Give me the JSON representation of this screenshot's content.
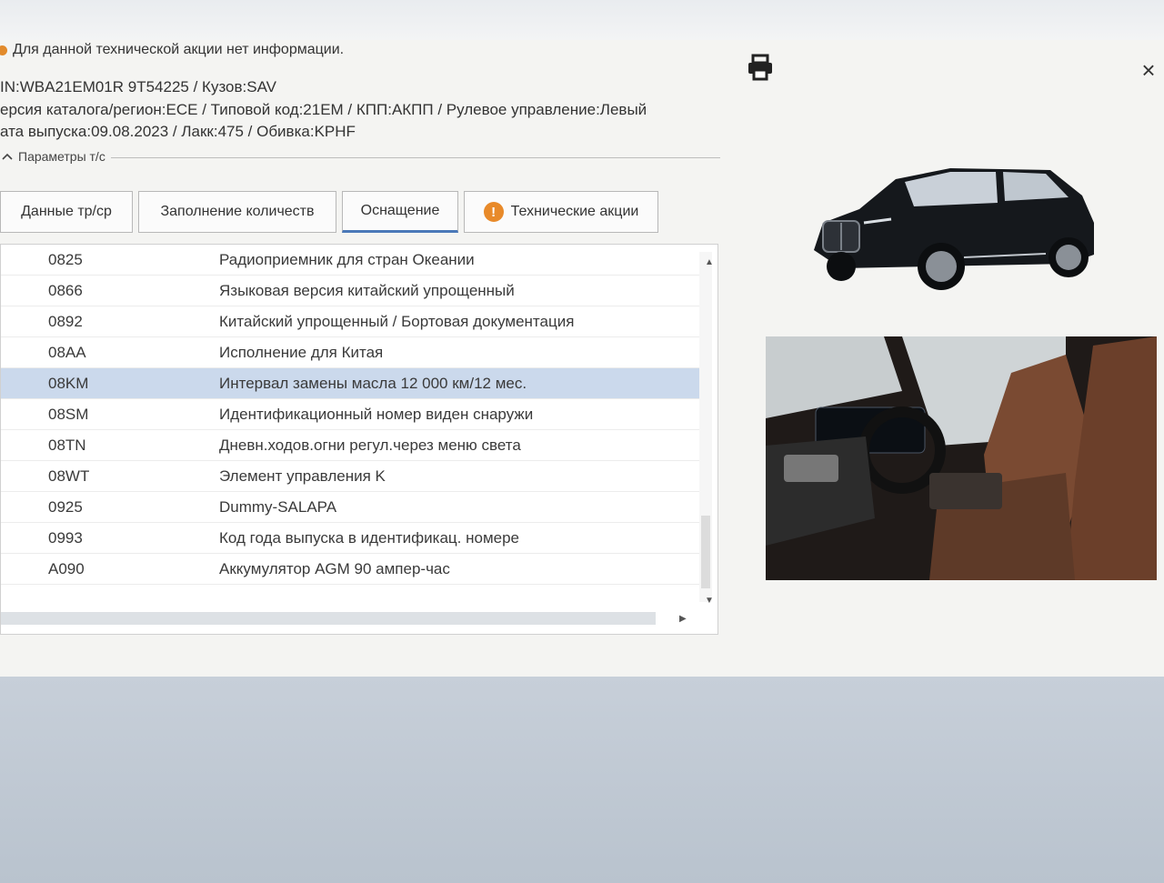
{
  "notice": {
    "text": "Для данной технической акции нет информации."
  },
  "vehicle": {
    "line1": "IN:WBA21EM01R 9T54225 / Кузов:SAV",
    "line2": "ерсия каталога/регион:ECE / Типовой код:21EM / КПП:АКПП / Рулевое управление:Левый",
    "line3": "ата выпуска:09.08.2023 / Лакк:475 / Обивка:KPHF"
  },
  "params": {
    "label": "Параметры т/с"
  },
  "tabs": [
    {
      "label": "Данные тр/ср"
    },
    {
      "label": "Заполнение количеств"
    },
    {
      "label": "Оснащение"
    },
    {
      "label": "Технические акции"
    }
  ],
  "equipment": [
    {
      "code": "0825",
      "desc": "Радиоприемник для стран Океании"
    },
    {
      "code": "0866",
      "desc": "Языковая версия китайский упрощенный"
    },
    {
      "code": "0892",
      "desc": "Китайский упрощенный / Бортовая документация"
    },
    {
      "code": "08AA",
      "desc": "Исполнение для Китая"
    },
    {
      "code": "08KM",
      "desc": "Интервал замены масла 12 000 км/12 мес."
    },
    {
      "code": "08SM",
      "desc": "Идентификационный номер виден снаружи"
    },
    {
      "code": "08TN",
      "desc": "Дневн.ходов.огни регул.через меню света"
    },
    {
      "code": "08WT",
      "desc": "Элемент управления K"
    },
    {
      "code": "0925",
      "desc": "Dummy-SALAPA"
    },
    {
      "code": "0993",
      "desc": "Код года выпуска в идентификац. номере"
    },
    {
      "code": "A090",
      "desc": "Аккумулятор AGM 90 ампер-час"
    }
  ],
  "icons": {
    "close": "close-icon",
    "print": "print-icon",
    "warning": "warning-icon",
    "collapse": "chevron-up-icon"
  },
  "colors": {
    "selection": "#cbd9ec",
    "warning": "#e88a2a",
    "active_tab": "#4a78b8"
  }
}
